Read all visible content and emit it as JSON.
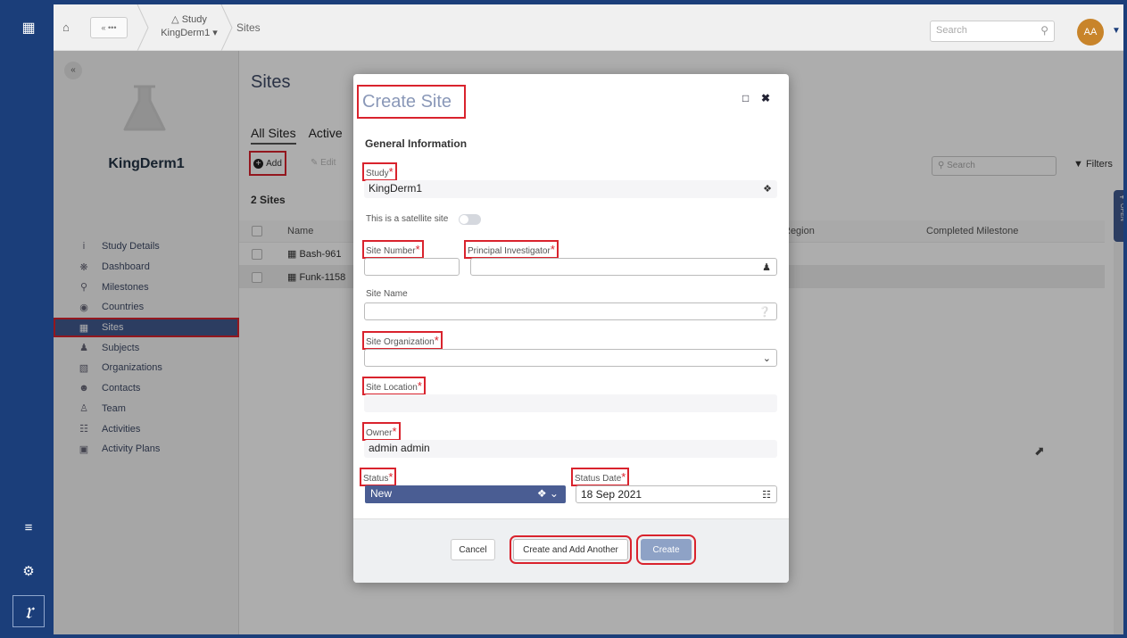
{
  "topbar": {
    "study_label": "Study",
    "study_value": "KingDerm1",
    "crumb_back": "«",
    "crumb_sites": "Sites",
    "search_placeholder": "Search",
    "avatar_initials": "AA"
  },
  "studypanel": {
    "study_name": "KingDerm1",
    "nav": [
      {
        "label": "Study Details",
        "icon": "info-icon"
      },
      {
        "label": "Dashboard",
        "icon": "dashboard-icon"
      },
      {
        "label": "Milestones",
        "icon": "map-pin-icon"
      },
      {
        "label": "Countries",
        "icon": "globe-icon"
      },
      {
        "label": "Sites",
        "icon": "building-icon",
        "active": true
      },
      {
        "label": "Subjects",
        "icon": "subject-icon"
      },
      {
        "label": "Organizations",
        "icon": "organization-icon"
      },
      {
        "label": "Contacts",
        "icon": "contacts-icon"
      },
      {
        "label": "Team",
        "icon": "team-icon"
      },
      {
        "label": "Activities",
        "icon": "calendar-icon"
      },
      {
        "label": "Activity Plans",
        "icon": "plan-icon"
      }
    ]
  },
  "main": {
    "title": "Sites",
    "tabs": [
      "All Sites",
      "Active"
    ],
    "add_label": "Add",
    "edit_label": "Edit",
    "count": "2 Sites",
    "search_placeholder": "Search",
    "filters_label": "Filters",
    "columns": {
      "name": "Name",
      "region": "Region",
      "milestone": "Completed Milestone"
    },
    "rows": [
      "Bash-961",
      "Funk-1158"
    ],
    "open_panel": "OPEN"
  },
  "modal": {
    "title": "Create Site",
    "section": "General Information",
    "study_label": "Study",
    "study_value": "KingDerm1",
    "satellite_label": "This is a satellite site",
    "site_number_label": "Site Number",
    "pi_label": "Principal Investigator",
    "site_name_label": "Site Name",
    "site_org_label": "Site Organization",
    "site_location_label": "Site Location",
    "owner_label": "Owner",
    "owner_value": "admin admin",
    "status_label": "Status",
    "status_value": "New",
    "status_date_label": "Status Date",
    "status_date_value": "18 Sep 2021",
    "cancel": "Cancel",
    "create_add_another": "Create and Add Another",
    "create": "Create"
  },
  "colors": {
    "navy": "#1b3e7a",
    "active_nav": "#415a8f",
    "highlight": "#d9232d",
    "avatar": "#c8842a"
  }
}
